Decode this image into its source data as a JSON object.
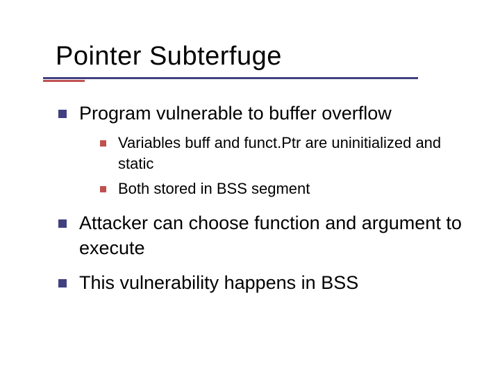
{
  "title": "Pointer Subterfuge",
  "bullets": {
    "b1": "Program vulnerable to buffer overflow",
    "b1_sub1": "Variables buff and funct.Ptr are uninitialized and static",
    "b1_sub2": "Both stored in BSS segment",
    "b2": "Attacker can choose function and argument to execute",
    "b3": "This vulnerability happens in BSS"
  }
}
